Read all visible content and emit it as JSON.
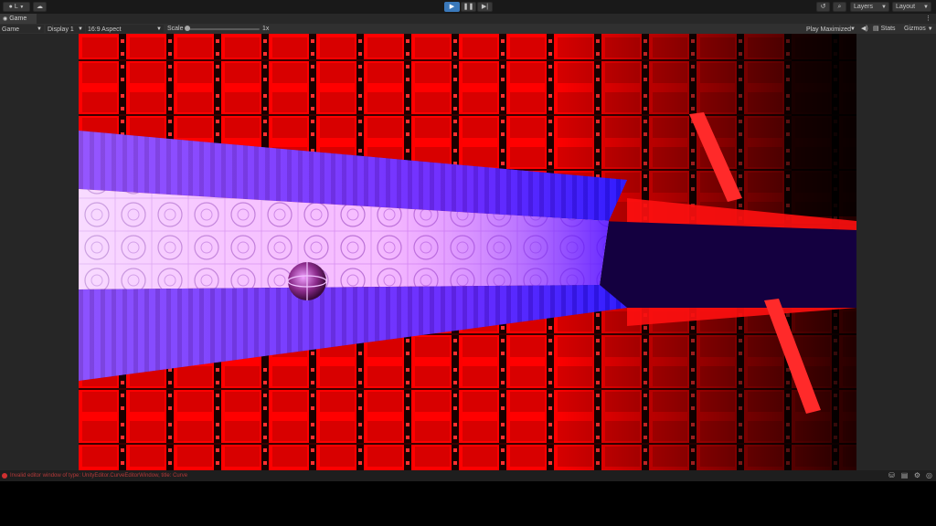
{
  "toolbar": {
    "account_label": "L",
    "layers_label": "Layers",
    "layout_label": "Layout"
  },
  "tab": {
    "title": "Game"
  },
  "game_controls": {
    "view_select": "Game",
    "display_select": "Display 1",
    "aspect_select": "16:9 Aspect",
    "scale_label": "Scale",
    "scale_value": "1x",
    "play_mode_select": "Play Maximized",
    "stats_label": "Stats",
    "gizmos_label": "Gizmos"
  },
  "status": {
    "message": "Invalid editor window of type: UnityEditor.CurveEditorWindow, title: Curve"
  },
  "colors": {
    "play_active": "#3a79bb",
    "error_text": "#b43a3a",
    "scene_red": "#ff0000",
    "scene_blue": "#2a22ff",
    "scene_magenta": "#e040ff"
  },
  "icons": [
    "account-icon",
    "cloud-icon",
    "play-icon",
    "pause-icon",
    "step-icon",
    "history-icon",
    "search-icon",
    "mute-icon",
    "more-icon",
    "error-icon"
  ]
}
